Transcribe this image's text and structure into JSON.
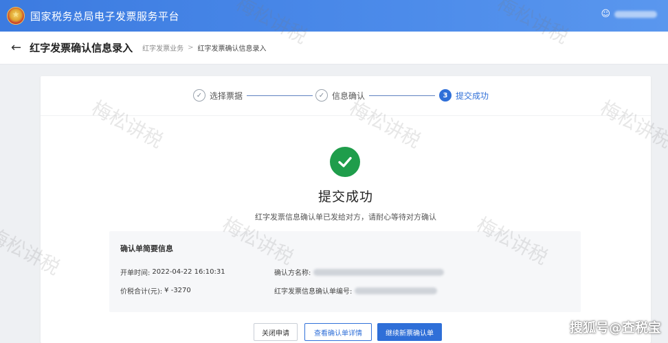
{
  "header": {
    "site_title": "国家税务总局电子发票服务平台"
  },
  "breadcrumb": {
    "back_icon": "arrow-left-icon",
    "page_title": "红字发票确认信息录入",
    "crumb_parent": "红字发票业务",
    "separator": ">",
    "crumb_current": "红字发票确认信息录入"
  },
  "steps": [
    {
      "index": "✓",
      "label": "选择票据",
      "state": "done"
    },
    {
      "index": "✓",
      "label": "信息确认",
      "state": "done"
    },
    {
      "index": "3",
      "label": "提交成功",
      "state": "active"
    }
  ],
  "result": {
    "title": "提交成功",
    "description": "红字发票信息确认单已发给对方，请耐心等待对方确认"
  },
  "summary": {
    "title": "确认单简要信息",
    "open_time_label": "开单时间:",
    "open_time_value": "2022-04-22 16:10:31",
    "confirm_party_label": "确认方名称:",
    "total_label": "价税合计(元):",
    "total_value": "¥ -3270",
    "confirm_no_label": "红字发票信息确认单编号:"
  },
  "buttons": {
    "close": "关闭申请",
    "view": "查看确认单详情",
    "new": "继续新票确认单"
  },
  "watermark": {
    "repeat_text": "梅松讲税",
    "brand": "搜狐号@查税宝"
  },
  "colors": {
    "primary": "#2f6fd8",
    "success": "#1f9d4b",
    "header": "#3c7be0"
  }
}
